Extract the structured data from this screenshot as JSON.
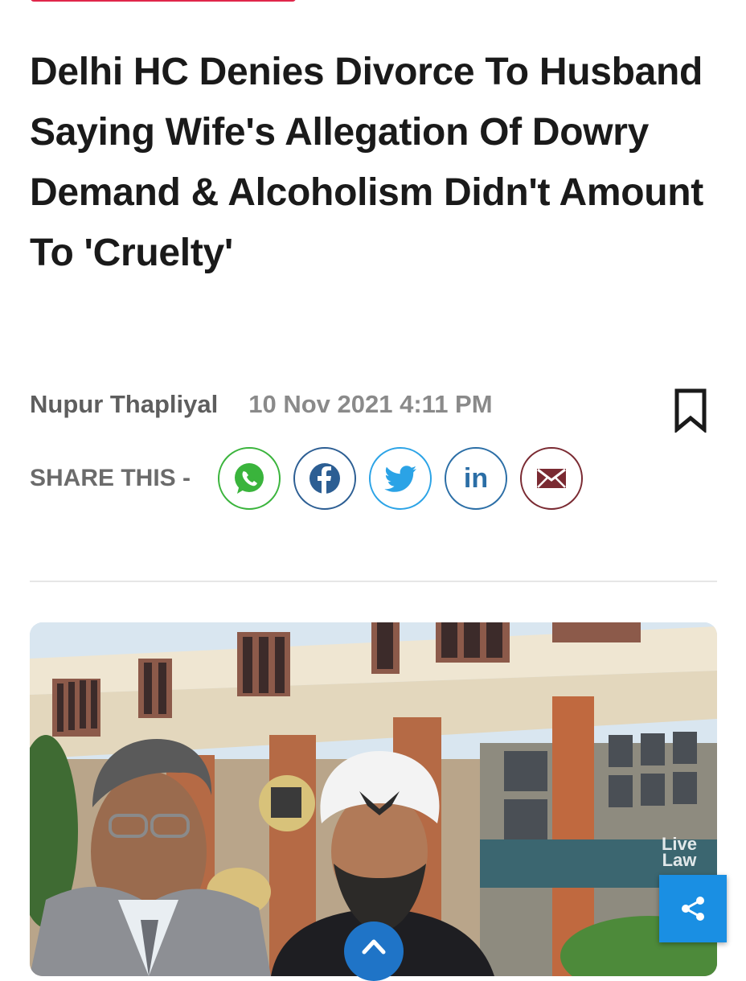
{
  "article": {
    "headline": "Delhi HC Denies Divorce To Husband Saying Wife's Allegation Of Dowry Demand & Alcoholism Didn't Amount To 'Cruelty'",
    "author": "Nupur Thapliyal",
    "date": "10 Nov 2021 4:11 PM"
  },
  "share": {
    "label": "SHARE THIS -",
    "buttons": [
      {
        "name": "whatsapp",
        "icon": "whatsapp-icon",
        "color": "#3ab43c"
      },
      {
        "name": "facebook",
        "icon": "facebook-icon",
        "color": "#2c5e93"
      },
      {
        "name": "twitter",
        "icon": "twitter-icon",
        "color": "#2ba3e6"
      },
      {
        "name": "linkedin",
        "icon": "linkedin-icon",
        "color": "#2b6ea6"
      },
      {
        "name": "email",
        "icon": "email-icon",
        "color": "#7a2a32"
      }
    ]
  },
  "hero_image": {
    "watermark": "Live Law"
  },
  "colors": {
    "tag": "#e0264a",
    "fab_share": "#1a8fe3",
    "fab_up": "#1f74c7"
  }
}
